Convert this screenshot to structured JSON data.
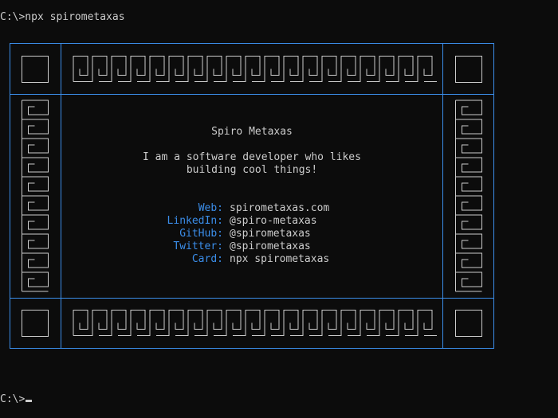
{
  "terminal": {
    "command_line": "C:\\>npx spirometaxas",
    "prompt_end": "C:\\>"
  },
  "card": {
    "name": "Spiro Metaxas",
    "bio_line1": "I am a software developer who likes",
    "bio_line2": "building cool things!",
    "links": [
      {
        "label": "Web:",
        "value": "spirometaxas.com"
      },
      {
        "label": "LinkedIn:",
        "value": "@spiro-metaxas"
      },
      {
        "label": "GitHub:",
        "value": "@spirometaxas"
      },
      {
        "label": "Twitter:",
        "value": "@spirometaxas"
      },
      {
        "label": "Card:",
        "value": "npx spirometaxas"
      }
    ]
  },
  "colors": {
    "background": "#0c0c0c",
    "text": "#cccccc",
    "frame": "#3b8eea",
    "label": "#3b8eea"
  }
}
